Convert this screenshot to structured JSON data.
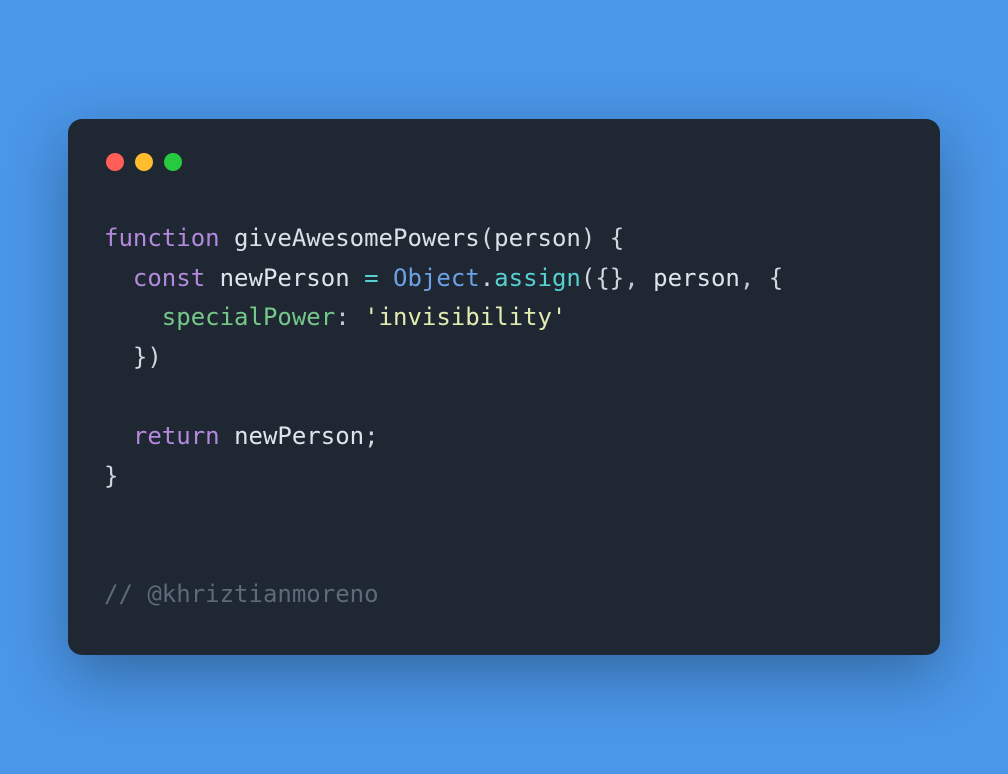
{
  "theme": {
    "background": "#4a96e8",
    "editorBackground": "#1e2732",
    "trafficLights": {
      "red": "#ff5f56",
      "yellow": "#ffbd2e",
      "green": "#27c93f"
    }
  },
  "code": {
    "lines": [
      {
        "tokens": [
          {
            "t": "function",
            "cls": "c-keyword-fn"
          },
          {
            "t": " ",
            "cls": ""
          },
          {
            "t": "giveAwesomePowers",
            "cls": "c-fn-name"
          },
          {
            "t": "(",
            "cls": "c-paren"
          },
          {
            "t": "person",
            "cls": "c-param"
          },
          {
            "t": ")",
            "cls": "c-paren"
          },
          {
            "t": " ",
            "cls": ""
          },
          {
            "t": "{",
            "cls": "c-brace"
          }
        ]
      },
      {
        "tokens": [
          {
            "t": "  ",
            "cls": ""
          },
          {
            "t": "const",
            "cls": "c-keyword"
          },
          {
            "t": " ",
            "cls": ""
          },
          {
            "t": "newPerson",
            "cls": "c-ident"
          },
          {
            "t": " ",
            "cls": ""
          },
          {
            "t": "=",
            "cls": "c-eq"
          },
          {
            "t": " ",
            "cls": ""
          },
          {
            "t": "Object",
            "cls": "c-builtin"
          },
          {
            "t": ".",
            "cls": "c-dot"
          },
          {
            "t": "assign",
            "cls": "c-method"
          },
          {
            "t": "(",
            "cls": "c-paren"
          },
          {
            "t": "{}",
            "cls": "c-brace"
          },
          {
            "t": ", ",
            "cls": ""
          },
          {
            "t": "person",
            "cls": "c-ident"
          },
          {
            "t": ", ",
            "cls": ""
          },
          {
            "t": "{",
            "cls": "c-brace"
          }
        ]
      },
      {
        "tokens": [
          {
            "t": "    ",
            "cls": ""
          },
          {
            "t": "specialPower",
            "cls": "c-prop"
          },
          {
            "t": ": ",
            "cls": ""
          },
          {
            "t": "'invisibility'",
            "cls": "c-string"
          }
        ]
      },
      {
        "tokens": [
          {
            "t": "  ",
            "cls": ""
          },
          {
            "t": "}",
            "cls": "c-brace"
          },
          {
            "t": ")",
            "cls": "c-paren"
          }
        ]
      },
      {
        "tokens": [
          {
            "t": " ",
            "cls": ""
          }
        ]
      },
      {
        "tokens": [
          {
            "t": "  ",
            "cls": ""
          },
          {
            "t": "return",
            "cls": "c-keyword"
          },
          {
            "t": " ",
            "cls": ""
          },
          {
            "t": "newPerson",
            "cls": "c-ident"
          },
          {
            "t": ";",
            "cls": "c-semi"
          }
        ]
      },
      {
        "tokens": [
          {
            "t": "}",
            "cls": "c-brace"
          }
        ]
      },
      {
        "tokens": [
          {
            "t": " ",
            "cls": ""
          }
        ]
      },
      {
        "tokens": [
          {
            "t": " ",
            "cls": ""
          }
        ]
      },
      {
        "tokens": [
          {
            "t": "// @khriztianmoreno",
            "cls": "c-comment"
          }
        ]
      }
    ]
  }
}
